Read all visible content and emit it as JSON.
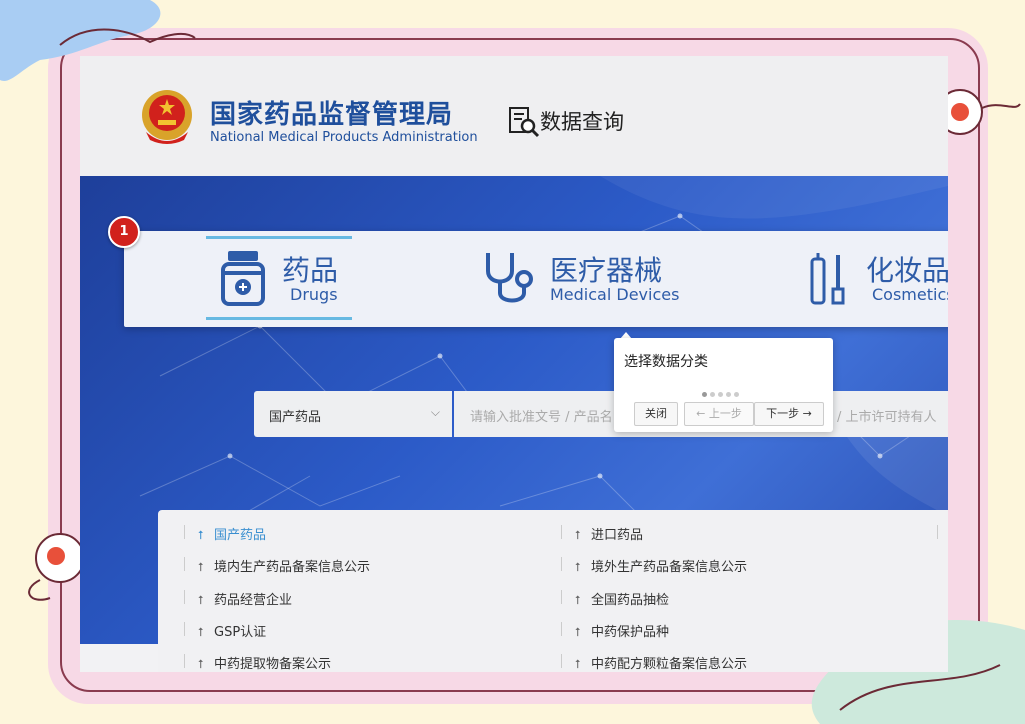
{
  "header": {
    "site_title_cn": "国家药品监督管理局",
    "site_title_en": "National Medical Products Administration",
    "data_query_label": "数据查询",
    "emblem_icon": "national-emblem-icon",
    "data_query_icon": "document-search-icon"
  },
  "tour_badge": "1",
  "categories": [
    {
      "cn": "药品",
      "en": "Drugs",
      "icon": "medicine-bottle-icon",
      "active": true
    },
    {
      "cn": "医疗器械",
      "en": "Medical Devices",
      "icon": "stethoscope-icon",
      "active": false
    },
    {
      "cn": "化妆品",
      "en": "Cosmetics",
      "icon": "cosmetics-icon",
      "active": false
    }
  ],
  "search": {
    "select_value": "国产药品",
    "placeholder_start": "请输入批准文号 / 产品名",
    "placeholder_end": "/ 上市许可持有人"
  },
  "tooltip": {
    "title": "选择数据分类",
    "step_count": 5,
    "current_step": 1,
    "close_label": "关闭",
    "prev_label": "← 上一步",
    "next_label": "下一步 →"
  },
  "data_links": {
    "left": [
      "国产药品",
      "境内生产药品备案信息公示",
      "药品经营企业",
      "GSP认证",
      "中药提取物备案公示"
    ],
    "right": [
      "进口药品",
      "境外生产药品备案信息公示",
      "全国药品抽检",
      "中药保护品种",
      "中药配方颗粒备案信息公示"
    ],
    "active_item": "国产药品"
  },
  "colors": {
    "brand_blue": "#1f4f9c",
    "category_blue": "#2e5ca8",
    "active_underline": "#67b9e2",
    "badge_red": "#d1211c",
    "active_link": "#3a8fd0",
    "banner_blue": "#2c5bc8"
  }
}
